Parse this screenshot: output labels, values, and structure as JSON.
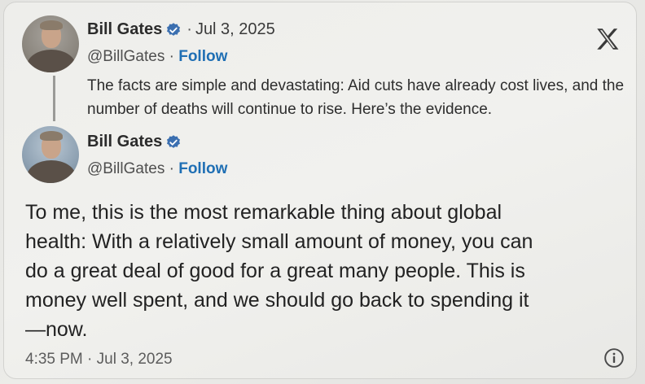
{
  "quoted_tweet": {
    "author_name": "Bill Gates",
    "date_prefix": "·",
    "date": "Jul 3, 2025",
    "handle": "@BillGates",
    "handle_sep": " · ",
    "follow_label": "Follow",
    "text": "The facts are simple and devastating: Aid cuts have already cost lives, and the number of deaths will continue to rise. Here’s the evidence."
  },
  "reply_tweet": {
    "author_name": "Bill Gates",
    "handle": "@BillGates",
    "handle_sep": " · ",
    "follow_label": "Follow",
    "text_lines": [
      "To me, this is the most remarkable thing about global",
      "health: With a relatively small amount of money, you can",
      "do a great deal of good for a great many people. This is",
      "money well spent, and we should go back to spending it",
      "—now."
    ],
    "timestamp": "4:35 PM · Jul 3, 2025"
  },
  "icons": {
    "platform_logo": "x-logo-icon",
    "verified": "verified-badge-icon",
    "info": "info-icon"
  },
  "colors": {
    "verified_badge": "#3b6fb0",
    "follow_link": "#1f6fb4",
    "text_primary": "#222222"
  }
}
